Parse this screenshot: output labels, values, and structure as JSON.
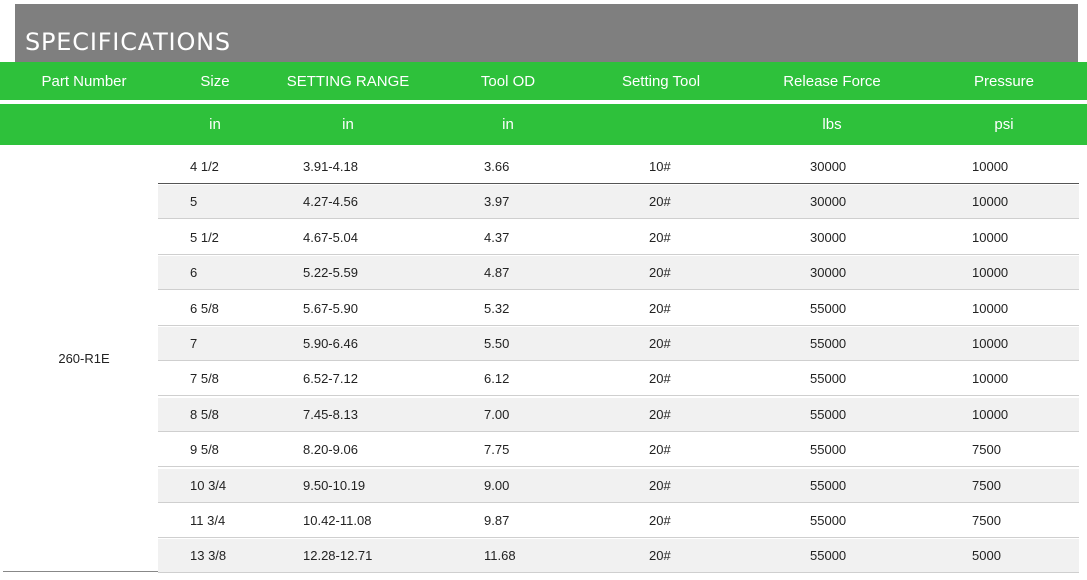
{
  "title": "SPECIFICATIONS",
  "header": {
    "part_number": "Part Number",
    "size": "Size",
    "setting_range": "SETTING RANGE",
    "tool_od": "Tool OD",
    "setting_tool": "Setting Tool",
    "release_force": "Release Force",
    "pressure": "Pressure"
  },
  "units": {
    "part_number": "",
    "size": "in",
    "setting_range": "in",
    "tool_od": "in",
    "setting_tool": "",
    "release_force": "lbs",
    "pressure": "psi"
  },
  "part_number": "260-R1E",
  "rows": [
    {
      "size": "4 1/2",
      "setting_range": "3.91-4.18",
      "tool_od": "3.66",
      "setting_tool": "10#",
      "release_force": "30000",
      "pressure": "10000"
    },
    {
      "size": "5",
      "setting_range": "4.27-4.56",
      "tool_od": "3.97",
      "setting_tool": "20#",
      "release_force": "30000",
      "pressure": "10000"
    },
    {
      "size": "5 1/2",
      "setting_range": "4.67-5.04",
      "tool_od": "4.37",
      "setting_tool": "20#",
      "release_force": "30000",
      "pressure": "10000"
    },
    {
      "size": "6",
      "setting_range": "5.22-5.59",
      "tool_od": "4.87",
      "setting_tool": "20#",
      "release_force": "30000",
      "pressure": "10000"
    },
    {
      "size": "6 5/8",
      "setting_range": "5.67-5.90",
      "tool_od": "5.32",
      "setting_tool": "20#",
      "release_force": "55000",
      "pressure": "10000"
    },
    {
      "size": "7",
      "setting_range": "5.90-6.46",
      "tool_od": "5.50",
      "setting_tool": "20#",
      "release_force": "55000",
      "pressure": "10000"
    },
    {
      "size": "7 5/8",
      "setting_range": "6.52-7.12",
      "tool_od": "6.12",
      "setting_tool": "20#",
      "release_force": "55000",
      "pressure": "10000"
    },
    {
      "size": "8 5/8",
      "setting_range": "7.45-8.13",
      "tool_od": "7.00",
      "setting_tool": "20#",
      "release_force": "55000",
      "pressure": "10000"
    },
    {
      "size": "9 5/8",
      "setting_range": "8.20-9.06",
      "tool_od": "7.75",
      "setting_tool": "20#",
      "release_force": "55000",
      "pressure": "7500"
    },
    {
      "size": "10 3/4",
      "setting_range": "9.50-10.19",
      "tool_od": "9.00",
      "setting_tool": "20#",
      "release_force": "55000",
      "pressure": "7500"
    },
    {
      "size": "11 3/4",
      "setting_range": "10.42-11.08",
      "tool_od": "9.87",
      "setting_tool": "20#",
      "release_force": "55000",
      "pressure": "7500"
    },
    {
      "size": "13 3/8",
      "setting_range": "12.28-12.71",
      "tool_od": "11.68",
      "setting_tool": "20#",
      "release_force": "55000",
      "pressure": "5000"
    }
  ],
  "colors": {
    "title_bar": "#7f7f7f",
    "header_green": "#2ec13b",
    "alt_row": "#f1f1f1"
  }
}
